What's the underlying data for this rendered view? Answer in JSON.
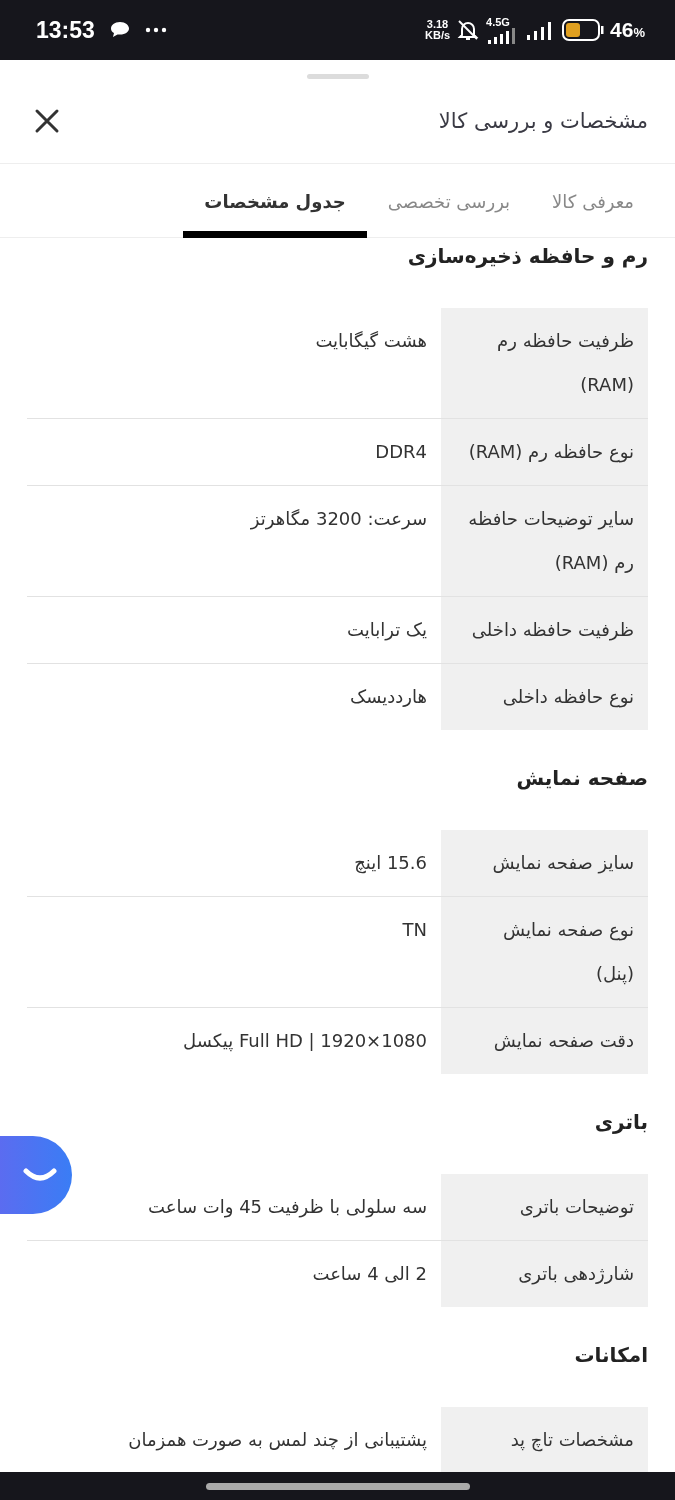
{
  "status_bar": {
    "time": "13:53",
    "speed_value": "3.18",
    "speed_unit": "KB/s",
    "network": "4.5G",
    "battery_percent": "46",
    "battery_unit": "%"
  },
  "sheet": {
    "title": "مشخصات و بررسی کالا"
  },
  "tabs": [
    {
      "label": "معرفی کالا",
      "selected": false
    },
    {
      "label": "بررسی تخصصی",
      "selected": false
    },
    {
      "label": "جدول مشخصات",
      "selected": true
    }
  ],
  "sections": [
    {
      "title": "رم و حافظه ذخیره‌سازی",
      "rows": [
        {
          "label": "ظرفیت حافظه رم (RAM)",
          "value": "هشت گیگابایت"
        },
        {
          "label": "نوع حافظه رم (RAM)",
          "value": "DDR4"
        },
        {
          "label": "سایر توضیحات حافظه رم (RAM)",
          "value": "سرعت: 3200 مگاهرتز"
        },
        {
          "label": "ظرفیت حافظه داخلی",
          "value": "یک ترابایت"
        },
        {
          "label": "نوع حافظه داخلی",
          "value": "هاردديسک"
        }
      ]
    },
    {
      "title": "صفحه نمایش",
      "rows": [
        {
          "label": "سایز صفحه نمایش",
          "value": "15.6 اینچ"
        },
        {
          "label": "نوع صفحه نمایش (پنل)",
          "value": "TN"
        },
        {
          "label": "دقت صفحه نمایش",
          "value": "Full HD | 1920×1080 پیکسل"
        }
      ]
    },
    {
      "title": "باتری",
      "rows": [
        {
          "label": "توضیحات باتری",
          "value": "سه سلولی با ظرفیت 45 وات ساعت"
        },
        {
          "label": "شارژدهی باتری",
          "value": "2 الی 4 ساعت"
        }
      ]
    },
    {
      "title": "امکانات",
      "rows": [
        {
          "label": "مشخصات تاچ پد",
          "value": "پشتیبانی از چند لمس به صورت همزمان"
        }
      ]
    }
  ]
}
